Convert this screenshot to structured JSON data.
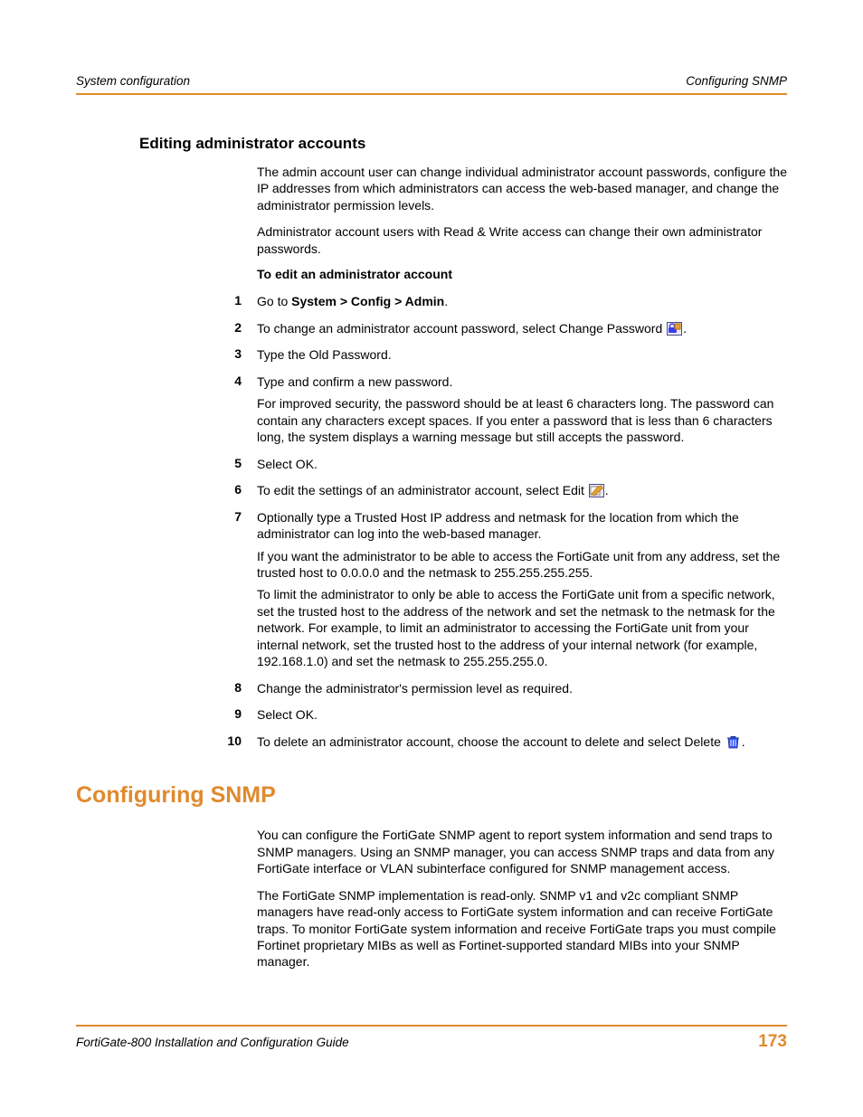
{
  "header": {
    "left": "System configuration",
    "right": "Configuring SNMP"
  },
  "section1": {
    "heading": "Editing administrator accounts",
    "p1": "The admin account user can change individual administrator account passwords, configure the IP addresses from which administrators can access the web-based manager, and change the administrator permission levels.",
    "p2": "Administrator account users with Read & Write access can change their own administrator passwords.",
    "sub": "To edit an administrator account",
    "steps": {
      "n1": "1",
      "s1a": "Go to ",
      "s1b": "System > Config > Admin",
      "s1c": ".",
      "n2": "2",
      "s2a": "To change an administrator account password, select Change Password ",
      "s2b": ".",
      "n3": "3",
      "s3": "Type the Old Password.",
      "n4": "4",
      "s4a": "Type and confirm a new password.",
      "s4b": "For improved security, the password should be at least 6 characters long. The password can contain any characters except spaces. If you enter a password that is less than 6 characters long, the system displays a warning message but still accepts the password.",
      "n5": "5",
      "s5": "Select OK.",
      "n6": "6",
      "s6a": "To edit the settings of an administrator account, select Edit ",
      "s6b": ".",
      "n7": "7",
      "s7a": "Optionally type a Trusted Host IP address and netmask for the location from which the administrator can log into the web-based manager.",
      "s7b": "If you want the administrator to be able to access the FortiGate unit from any address, set the trusted host to 0.0.0.0 and the netmask to 255.255.255.255.",
      "s7c": "To limit the administrator to only be able to access the FortiGate unit from a specific network, set the trusted host to the address of the network and set the netmask to the netmask for the network. For example, to limit an administrator to accessing the FortiGate unit from your internal network, set the trusted host to the address of your internal network (for example, 192.168.1.0) and set the netmask to 255.255.255.0.",
      "n8": "8",
      "s8": "Change the administrator's permission level as required.",
      "n9": "9",
      "s9": "Select OK.",
      "n10": "10",
      "s10a": "To delete an administrator account, choose the account to delete and select Delete ",
      "s10b": "."
    }
  },
  "section2": {
    "heading": "Configuring SNMP",
    "p1": "You can configure the FortiGate SNMP agent to report system information and send traps to SNMP managers. Using an SNMP manager, you can access SNMP traps and data from any FortiGate interface or VLAN subinterface configured for SNMP management access.",
    "p2": "The FortiGate SNMP implementation is read-only. SNMP v1 and v2c compliant SNMP managers have read-only access to FortiGate system information and can receive FortiGate traps. To monitor FortiGate system information and receive FortiGate traps you must compile Fortinet proprietary MIBs as well as Fortinet-supported standard MIBs into your SNMP manager."
  },
  "footer": {
    "left": "FortiGate-800 Installation and Configuration Guide",
    "right": "173"
  }
}
